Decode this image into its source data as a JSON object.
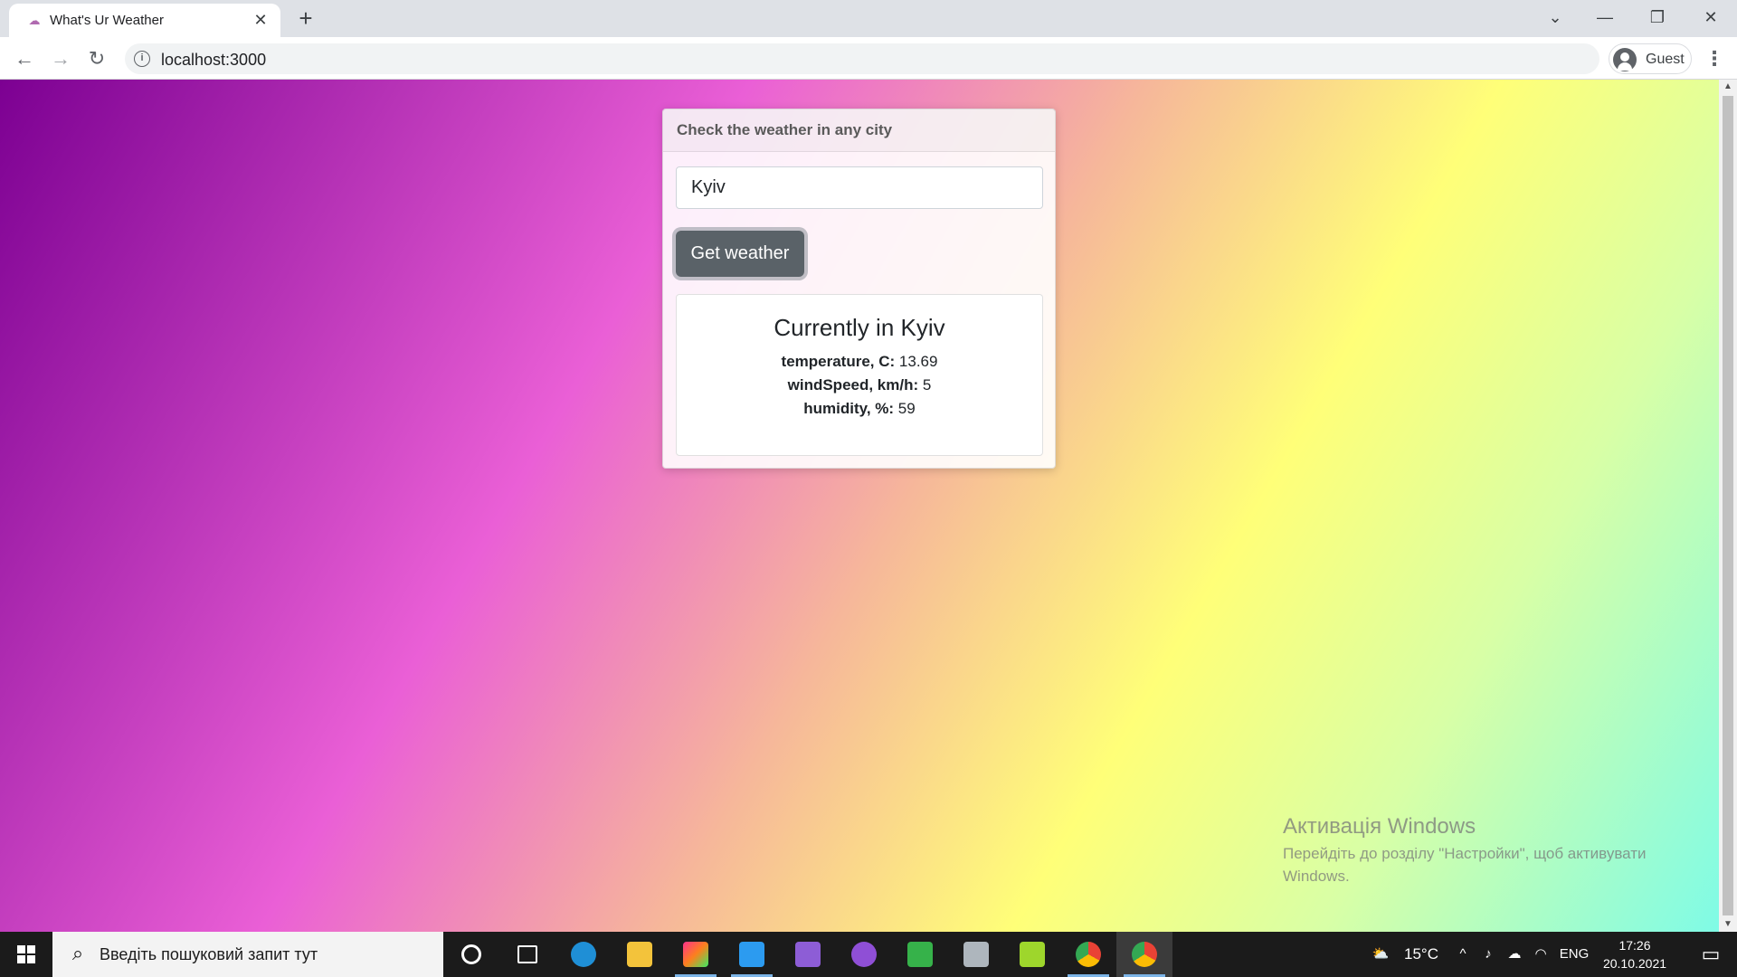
{
  "browser": {
    "tab_title": "What's Ur Weather",
    "tab_close": "✕",
    "new_tab": "+",
    "url": "localhost:3000",
    "profile_label": "Guest",
    "window_controls": {
      "tab_search": "⌄",
      "minimize": "—",
      "restore": "❐",
      "close": "✕"
    },
    "nav": {
      "back": "←",
      "forward": "→",
      "reload": "↻",
      "menu": "⋮"
    }
  },
  "app": {
    "header": "Check the weather in any city",
    "city_input": {
      "value": "Kyiv"
    },
    "button_label": "Get weather",
    "result": {
      "title": "Currently in Kyiv",
      "metrics": [
        {
          "label": "temperature, C:",
          "value": "13.69"
        },
        {
          "label": "windSpeed, km/h:",
          "value": "5"
        },
        {
          "label": "humidity, %:",
          "value": "59"
        }
      ]
    }
  },
  "activation": {
    "title": "Активація Windows",
    "subtitle": "Перейдіть до розділу \"Настройки\", щоб активувати Windows."
  },
  "taskbar": {
    "search_placeholder": "Введіть пошуковий запит тут",
    "apps": [
      {
        "name": "cortana-icon",
        "color": "#1b1b1b"
      },
      {
        "name": "task-view-icon",
        "color": "#1b1b1b"
      },
      {
        "name": "edge-icon",
        "color": "#1f8fd6"
      },
      {
        "name": "file-explorer-icon",
        "color": "#f3c33b"
      },
      {
        "name": "intellij-icon",
        "color": "#ff318c"
      },
      {
        "name": "vscode-icon",
        "color": "#2c9bf0"
      },
      {
        "name": "visual-studio-icon",
        "color": "#8d5dd6"
      },
      {
        "name": "github-desktop-icon",
        "color": "#8f4fd6"
      },
      {
        "name": "git-kraken-icon",
        "color": "#36b24a"
      },
      {
        "name": "calculator-icon",
        "color": "#aeb6bd"
      },
      {
        "name": "green-app-icon",
        "color": "#9ed62c"
      },
      {
        "name": "chrome-guest-icon",
        "color": "#e94235"
      },
      {
        "name": "chrome-icon",
        "color": "#e94235"
      }
    ],
    "weather_temp": "15°C",
    "language": "ENG",
    "time": "17:26",
    "date": "20.10.2021"
  }
}
